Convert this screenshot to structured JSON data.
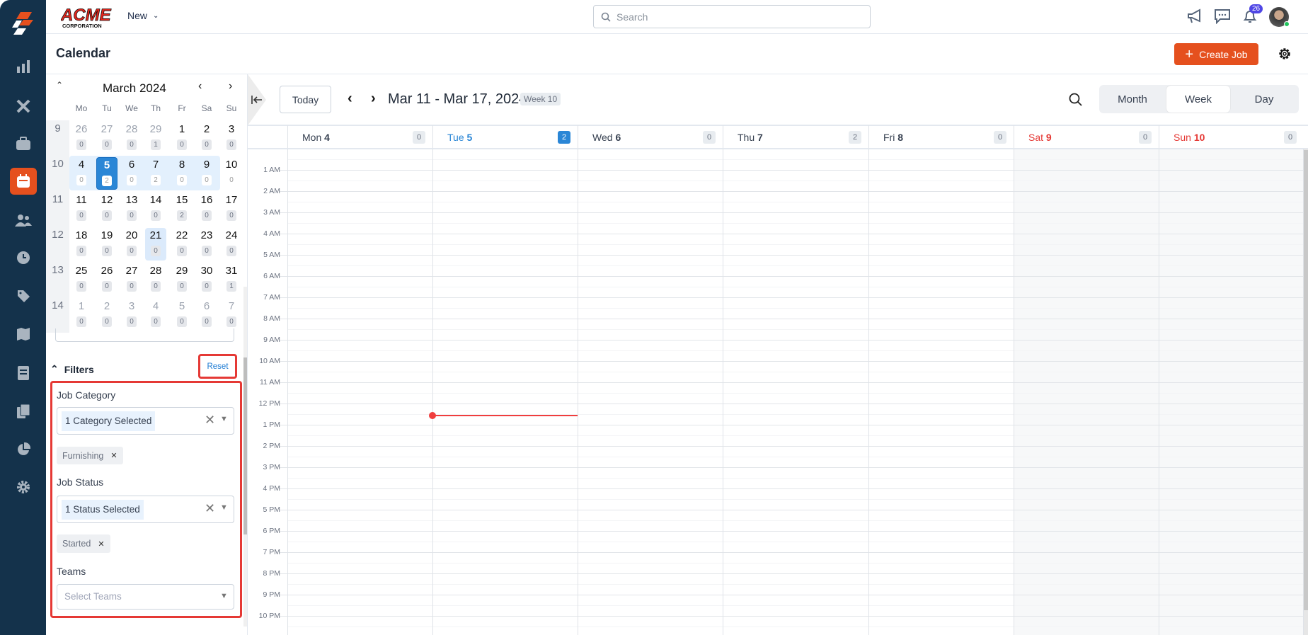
{
  "app": {
    "logo_text": "ACME CORPORATION",
    "new_label": "New",
    "search_placeholder": "Search",
    "notification_count": "26"
  },
  "page": {
    "title": "Calendar",
    "create_job_label": "Create Job"
  },
  "colors": {
    "sidebar": "#14324b",
    "accent": "#e5501e",
    "selected": "#2a86d6",
    "weekend": "#e53935",
    "now_line": "#f03e3e"
  },
  "sidebar": {
    "items": [
      "logo",
      "reports",
      "tools",
      "jobs",
      "calendar",
      "team",
      "timesheets",
      "tags",
      "map",
      "invoices",
      "documents",
      "analytics",
      "settings"
    ],
    "active": "calendar"
  },
  "mini_calendar": {
    "title": "March 2024",
    "weekday_labels": [
      "Mo",
      "Tu",
      "We",
      "Th",
      "Fr",
      "Sa",
      "Su"
    ],
    "weeks": [
      {
        "week": "9",
        "days": [
          "26",
          "27",
          "28",
          "29",
          "1",
          "2",
          "3"
        ],
        "counts": [
          "0",
          "0",
          "0",
          "1",
          "0",
          "0",
          "0"
        ],
        "muted": [
          true,
          true,
          true,
          true,
          false,
          false,
          false
        ]
      },
      {
        "week": "10",
        "days": [
          "4",
          "5",
          "6",
          "7",
          "8",
          "9",
          "10"
        ],
        "counts": [
          "0",
          "2",
          "0",
          "2",
          "0",
          "0",
          "0"
        ],
        "muted": [
          false,
          false,
          false,
          false,
          false,
          false,
          false
        ],
        "highlighted": true,
        "selected_index": 1
      },
      {
        "week": "11",
        "days": [
          "11",
          "12",
          "13",
          "14",
          "15",
          "16",
          "17"
        ],
        "counts": [
          "0",
          "0",
          "0",
          "0",
          "2",
          "0",
          "0"
        ],
        "muted": [
          false,
          false,
          false,
          false,
          false,
          false,
          false
        ]
      },
      {
        "week": "12",
        "days": [
          "18",
          "19",
          "20",
          "21",
          "22",
          "23",
          "24"
        ],
        "counts": [
          "0",
          "0",
          "0",
          "0",
          "0",
          "0",
          "0"
        ],
        "muted": [
          false,
          false,
          false,
          false,
          false,
          false,
          false
        ],
        "today_index": 3
      },
      {
        "week": "13",
        "days": [
          "25",
          "26",
          "27",
          "28",
          "29",
          "30",
          "31"
        ],
        "counts": [
          "0",
          "0",
          "0",
          "0",
          "0",
          "0",
          "1"
        ],
        "muted": [
          false,
          false,
          false,
          false,
          false,
          false,
          false
        ]
      },
      {
        "week": "14",
        "days": [
          "1",
          "2",
          "3",
          "4",
          "5",
          "6",
          "7"
        ],
        "counts": [
          "0",
          "0",
          "0",
          "0",
          "0",
          "0",
          "0"
        ],
        "muted": [
          true,
          true,
          true,
          true,
          true,
          true,
          true
        ]
      }
    ]
  },
  "filters": {
    "title": "Filters",
    "reset_label": "Reset",
    "job_category": {
      "label": "Job Category",
      "value": "1 Category Selected",
      "chips": [
        "Furnishing"
      ]
    },
    "job_status": {
      "label": "Job Status",
      "value": "1 Status Selected",
      "chips": [
        "Started"
      ]
    },
    "teams": {
      "label": "Teams",
      "placeholder": "Select Teams"
    }
  },
  "toolbar": {
    "today_label": "Today",
    "range_title": "Mar 11 - Mar 17, 2024",
    "week_badge": "Week 10",
    "views": [
      "Month",
      "Week",
      "Day"
    ],
    "active_view": "Week"
  },
  "days": [
    {
      "name": "Mon",
      "num": "4",
      "count": "0",
      "type": "normal"
    },
    {
      "name": "Tue",
      "num": "5",
      "count": "2",
      "type": "selected"
    },
    {
      "name": "Wed",
      "num": "6",
      "count": "0",
      "type": "normal"
    },
    {
      "name": "Thu",
      "num": "7",
      "count": "2",
      "type": "normal"
    },
    {
      "name": "Fri",
      "num": "8",
      "count": "0",
      "type": "normal"
    },
    {
      "name": "Sat",
      "num": "9",
      "count": "0",
      "type": "weekend"
    },
    {
      "name": "Sun",
      "num": "10",
      "count": "0",
      "type": "weekend"
    }
  ],
  "hours": [
    "1 AM",
    "2 AM",
    "3 AM",
    "4 AM",
    "5 AM",
    "6 AM",
    "7 AM",
    "8 AM",
    "9 AM",
    "10 AM",
    "11 AM",
    "12 PM",
    "1 PM",
    "2 PM",
    "3 PM",
    "4 PM",
    "5 PM",
    "6 PM",
    "7 PM",
    "8 PM",
    "9 PM",
    "10 PM"
  ]
}
